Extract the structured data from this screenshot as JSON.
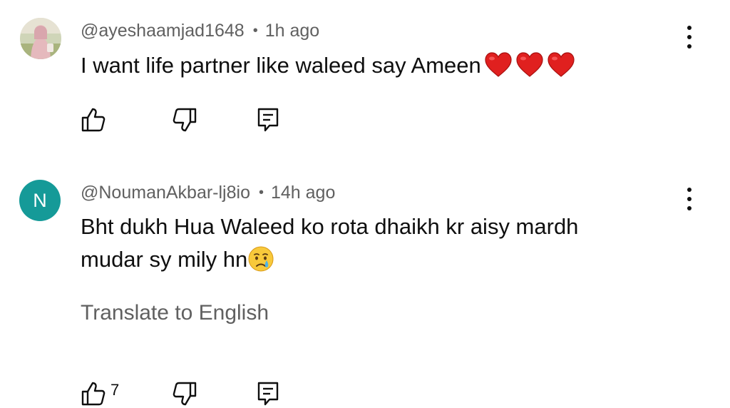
{
  "comments": [
    {
      "avatar": {
        "type": "image",
        "icon": "profile-photo"
      },
      "handle": "@ayeshaamjad1648",
      "separator": "•",
      "time": "1h ago",
      "text": "I want life partner like waleed say Ameen",
      "emojis": [
        "red-heart",
        "red-heart",
        "red-heart"
      ],
      "actions": {
        "like_icon": "thumbs-up-icon",
        "dislike_icon": "thumbs-down-icon",
        "reply_icon": "reply-icon"
      },
      "menu_icon": "more-vertical-icon"
    },
    {
      "avatar": {
        "type": "initial",
        "initial": "N",
        "color": "#159a98"
      },
      "handle": "@NoumanAkbar-lj8io",
      "separator": "•",
      "time": "14h ago",
      "text_line1": "Bht dukh Hua Waleed ko rota dhaikh kr aisy mardh",
      "text_line2": "mudar sy mily hn",
      "emojis": [
        "crying-face"
      ],
      "translate_label": "Translate to English",
      "like_count": "7",
      "actions": {
        "like_icon": "thumbs-up-icon",
        "dislike_icon": "thumbs-down-icon",
        "reply_icon": "reply-icon"
      },
      "menu_icon": "more-vertical-icon"
    }
  ],
  "colors": {
    "text_primary": "#0f0f0f",
    "text_secondary": "#606060",
    "avatar_n": "#159a98",
    "heart": "#e0201f"
  }
}
